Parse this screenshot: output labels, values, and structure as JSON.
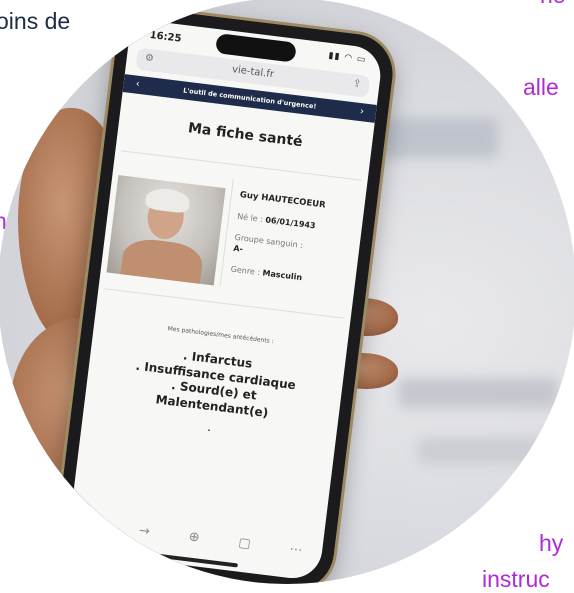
{
  "background_words": [
    "oins de",
    "ne",
    "alle",
    "n",
    "hy",
    "instruc"
  ],
  "phone": {
    "status_time": "16:25",
    "status_icons": "▮▮ ◠ ▭",
    "url": "vie-tal.fr",
    "banner_text": "L'outil de communication d'urgence!",
    "title": "Ma fiche santé",
    "patient": {
      "name": "Guy HAUTECOEUR",
      "born_label": "Né le :",
      "born_value": "06/01/1943",
      "blood_label": "Groupe sanguin :",
      "blood_value": "A-",
      "gender_label": "Genre :",
      "gender_value": "Masculin"
    },
    "pathologies_label": "Mes pathologies/mes antécédents :",
    "pathologies": [
      ". Infarctus",
      ". Insuffisance cardiaque",
      ". Sourd(e) et",
      "Malentendant(e)"
    ],
    "trailing_dot": "."
  },
  "colors": {
    "banner": "#1e2b4a",
    "accent_text": "#b02bd6",
    "dark_text": "#1f2a44"
  }
}
